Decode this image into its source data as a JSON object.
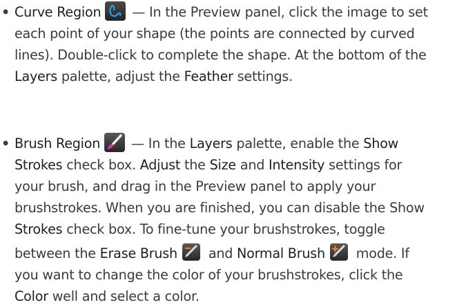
{
  "items": [
    {
      "bullet": "•",
      "lines": [
        {
          "parts": [
            {
              "text": "Curve Region",
              "bold": true
            },
            {
              "icon": "curve-region-icon"
            },
            {
              "text": " — In the Preview panel, click the image to set"
            }
          ]
        },
        {
          "parts": [
            {
              "text": "each point of your shape (the points are connected by curved"
            }
          ]
        },
        {
          "parts": [
            {
              "text": "lines). Double-click to complete the shape. At the bottom of the"
            }
          ]
        },
        {
          "parts": [
            {
              "text": "Layers",
              "bold": true
            },
            {
              "text": " palette, adjust the "
            },
            {
              "text": "Feather",
              "bold": true
            },
            {
              "text": " settings."
            }
          ]
        }
      ]
    },
    {
      "bullet": "•",
      "lines": [
        {
          "parts": [
            {
              "text": "Brush Region",
              "bold": true
            },
            {
              "icon": "brush-region-icon"
            },
            {
              "text": " — In the "
            },
            {
              "text": "Layers",
              "bold": true
            },
            {
              "text": " palette, enable the "
            },
            {
              "text": "Show",
              "bold": true
            }
          ]
        },
        {
          "parts": [
            {
              "text": "Strokes",
              "bold": true
            },
            {
              "text": " check box. "
            },
            {
              "text": "Adjust",
              "bold": true
            },
            {
              "text": " the "
            },
            {
              "text": "Size",
              "bold": true
            },
            {
              "text": " and "
            },
            {
              "text": "Intensity",
              "bold": true
            },
            {
              "text": " settings for"
            }
          ]
        },
        {
          "parts": [
            {
              "text": "your brush, and drag in the Preview panel to apply your"
            }
          ]
        },
        {
          "parts": [
            {
              "text": "brushstrokes. When you are finished, you can disable the Show"
            }
          ]
        },
        {
          "parts": [
            {
              "text": "Strokes",
              "bold": true
            },
            {
              "text": " check box. To fine-tune your brushstrokes, toggle"
            }
          ]
        },
        {
          "parts": [
            {
              "text": "between the "
            },
            {
              "text": "Erase Brush",
              "bold": true
            },
            {
              "icon": "erase-brush-icon"
            },
            {
              "text": " and "
            },
            {
              "text": "Normal Brush",
              "bold": true
            },
            {
              "icon": "normal-brush-icon"
            },
            {
              "text": " mode. If"
            }
          ]
        },
        {
          "parts": [
            {
              "text": "you want to change the color of your brushstrokes, click the"
            }
          ]
        },
        {
          "parts": [
            {
              "text": "Color",
              "bold": true
            },
            {
              "text": " well and select a color."
            }
          ]
        }
      ]
    }
  ]
}
